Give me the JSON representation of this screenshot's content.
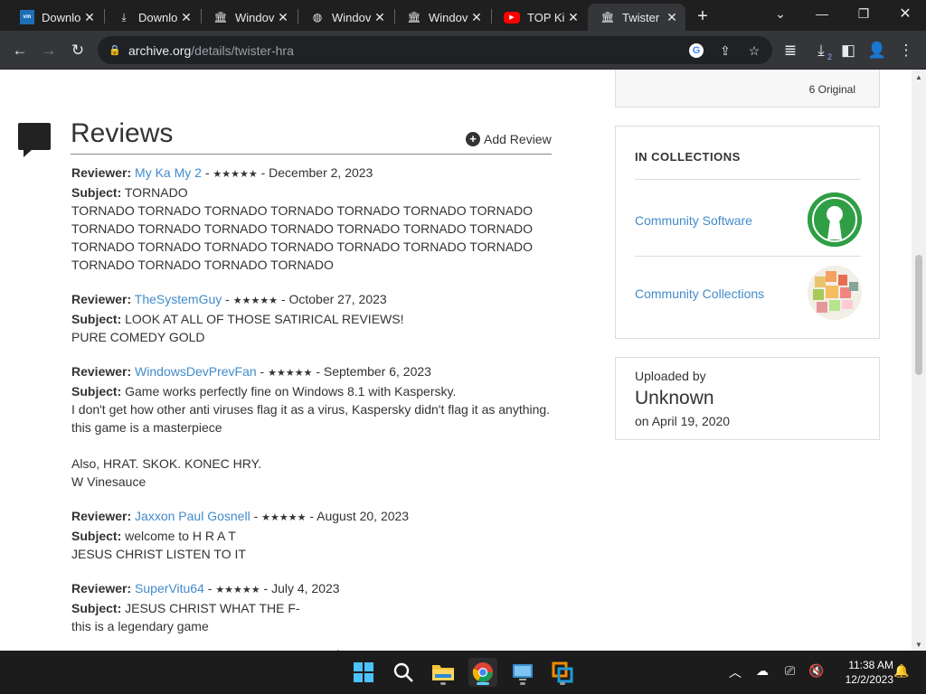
{
  "browser": {
    "tabs": [
      {
        "title": "Downlo",
        "icon": "vmware-icon"
      },
      {
        "title": "Downlo",
        "icon": "download-icon"
      },
      {
        "title": "Windov",
        "icon": "archive-icon"
      },
      {
        "title": "Windov",
        "icon": "globe-icon"
      },
      {
        "title": "Windov",
        "icon": "archive-icon"
      },
      {
        "title": "TOP Kid",
        "icon": "youtube-icon"
      },
      {
        "title": "Twister",
        "icon": "archive-icon",
        "active": true
      }
    ],
    "url_host": "archive.org",
    "url_path": "/details/twister-hra",
    "download_badge": "2"
  },
  "meta": {
    "original_count": "6 Original"
  },
  "reviews": {
    "title": "Reviews",
    "add_label": "Add Review",
    "reviewer_label": "Reviewer:",
    "subject_label": "Subject:",
    "items": [
      {
        "name": "My Ka My 2",
        "stars": "★★★★★",
        "date": "- December 2, 2023",
        "subject": "TORNADO",
        "body": "TORNADO TORNADO TORNADO TORNADO TORNADO TORNADO TORNADO\nTORNADO TORNADO TORNADO TORNADO TORNADO TORNADO TORNADO\nTORNADO TORNADO TORNADO TORNADO TORNADO TORNADO TORNADO\nTORNADO TORNADO TORNADO TORNADO"
      },
      {
        "name": "TheSystemGuy",
        "stars": "★★★★★",
        "date": "- October 27, 2023",
        "subject": "LOOK AT ALL OF THOSE SATIRICAL REVIEWS!",
        "body": "PURE COMEDY GOLD"
      },
      {
        "name": "WindowsDevPrevFan",
        "stars": "★★★★★",
        "date": "- September 6, 2023",
        "subject": "Game works perfectly fine on Windows 8.1 with Kaspersky.",
        "body": "I don't get how other anti viruses flag it as a virus, Kaspersky didn't flag it as anything.\nthis game is a masterpiece\n\nAlso, HRAT. SKOK. KONEC HRY.\nW Vinesauce"
      },
      {
        "name": "Jaxxon Paul Gosnell",
        "stars": "★★★★★",
        "date": "- August 20, 2023",
        "subject": "welcome to H R A T",
        "body": "JESUS CHRIST LISTEN TO IT"
      },
      {
        "name": "SuperVitu64",
        "stars": "★★★★★",
        "date": "- July 4, 2023",
        "subject": "JESUS CHRIST WHAT THE F-",
        "body": "this is a legendary game"
      }
    ]
  },
  "collections": {
    "heading": "IN COLLECTIONS",
    "items": [
      {
        "name": "Community Software",
        "image": "community-software-logo"
      },
      {
        "name": "Community Collections",
        "image": "community-collections-mosaic"
      }
    ]
  },
  "uploader": {
    "label": "Uploaded by",
    "name": "Unknown",
    "date": "on April 19, 2020"
  },
  "taskbar": {
    "time": "11:38 AM",
    "date": "12/2/2023"
  }
}
